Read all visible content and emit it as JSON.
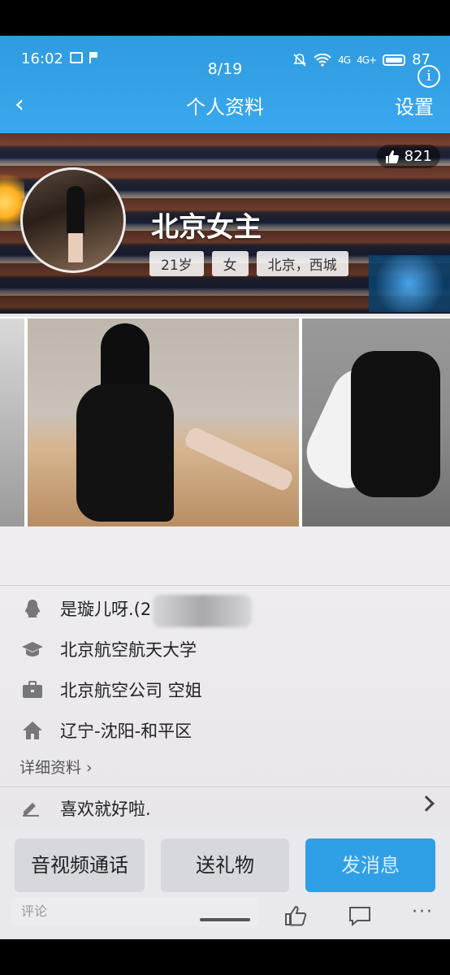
{
  "status_bar": {
    "time": "16:02",
    "signal_1": "4G",
    "signal_2": "4G+",
    "battery": "87"
  },
  "header": {
    "counter": "8/19",
    "title": "个人资料",
    "settings_label": "设置",
    "back_glyph": "‹",
    "info_glyph": "i"
  },
  "profile": {
    "name": "北京女主",
    "likes": "821",
    "tags": [
      "21岁",
      "女",
      "北京，西城"
    ]
  },
  "info_rows": {
    "nickname": "是璇儿呀.(2",
    "school": "北京航空航天大学",
    "job": "北京航空公司 空姐",
    "hometown": "辽宁-沈阳-和平区",
    "detail_link": "详细资料 ›",
    "signature": "喜欢就好啦."
  },
  "actions": {
    "call": "音视频通话",
    "gift": "送礼物",
    "message": "发消息",
    "comment_placeholder": "评论",
    "more": "···"
  },
  "colors": {
    "accent": "#2f9fe6",
    "header_bg": "#3aa8ee"
  }
}
